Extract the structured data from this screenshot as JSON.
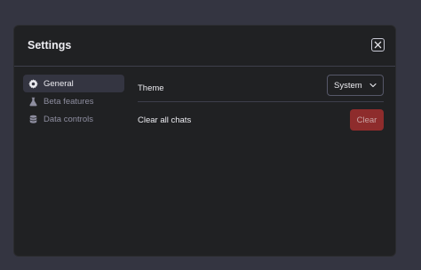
{
  "modal": {
    "title": "Settings",
    "close_icon": "close-icon"
  },
  "sidebar": {
    "items": [
      {
        "label": "General",
        "icon": "gear-icon",
        "active": true
      },
      {
        "label": "Beta features",
        "icon": "flask-icon",
        "active": false
      },
      {
        "label": "Data controls",
        "icon": "database-icon",
        "active": false
      }
    ]
  },
  "general": {
    "theme_label": "Theme",
    "theme_value": "System",
    "clear_label": "Clear all chats",
    "clear_button": "Clear"
  },
  "colors": {
    "background": "#343541",
    "modal": "#202123",
    "danger": "#8e2c2c"
  }
}
